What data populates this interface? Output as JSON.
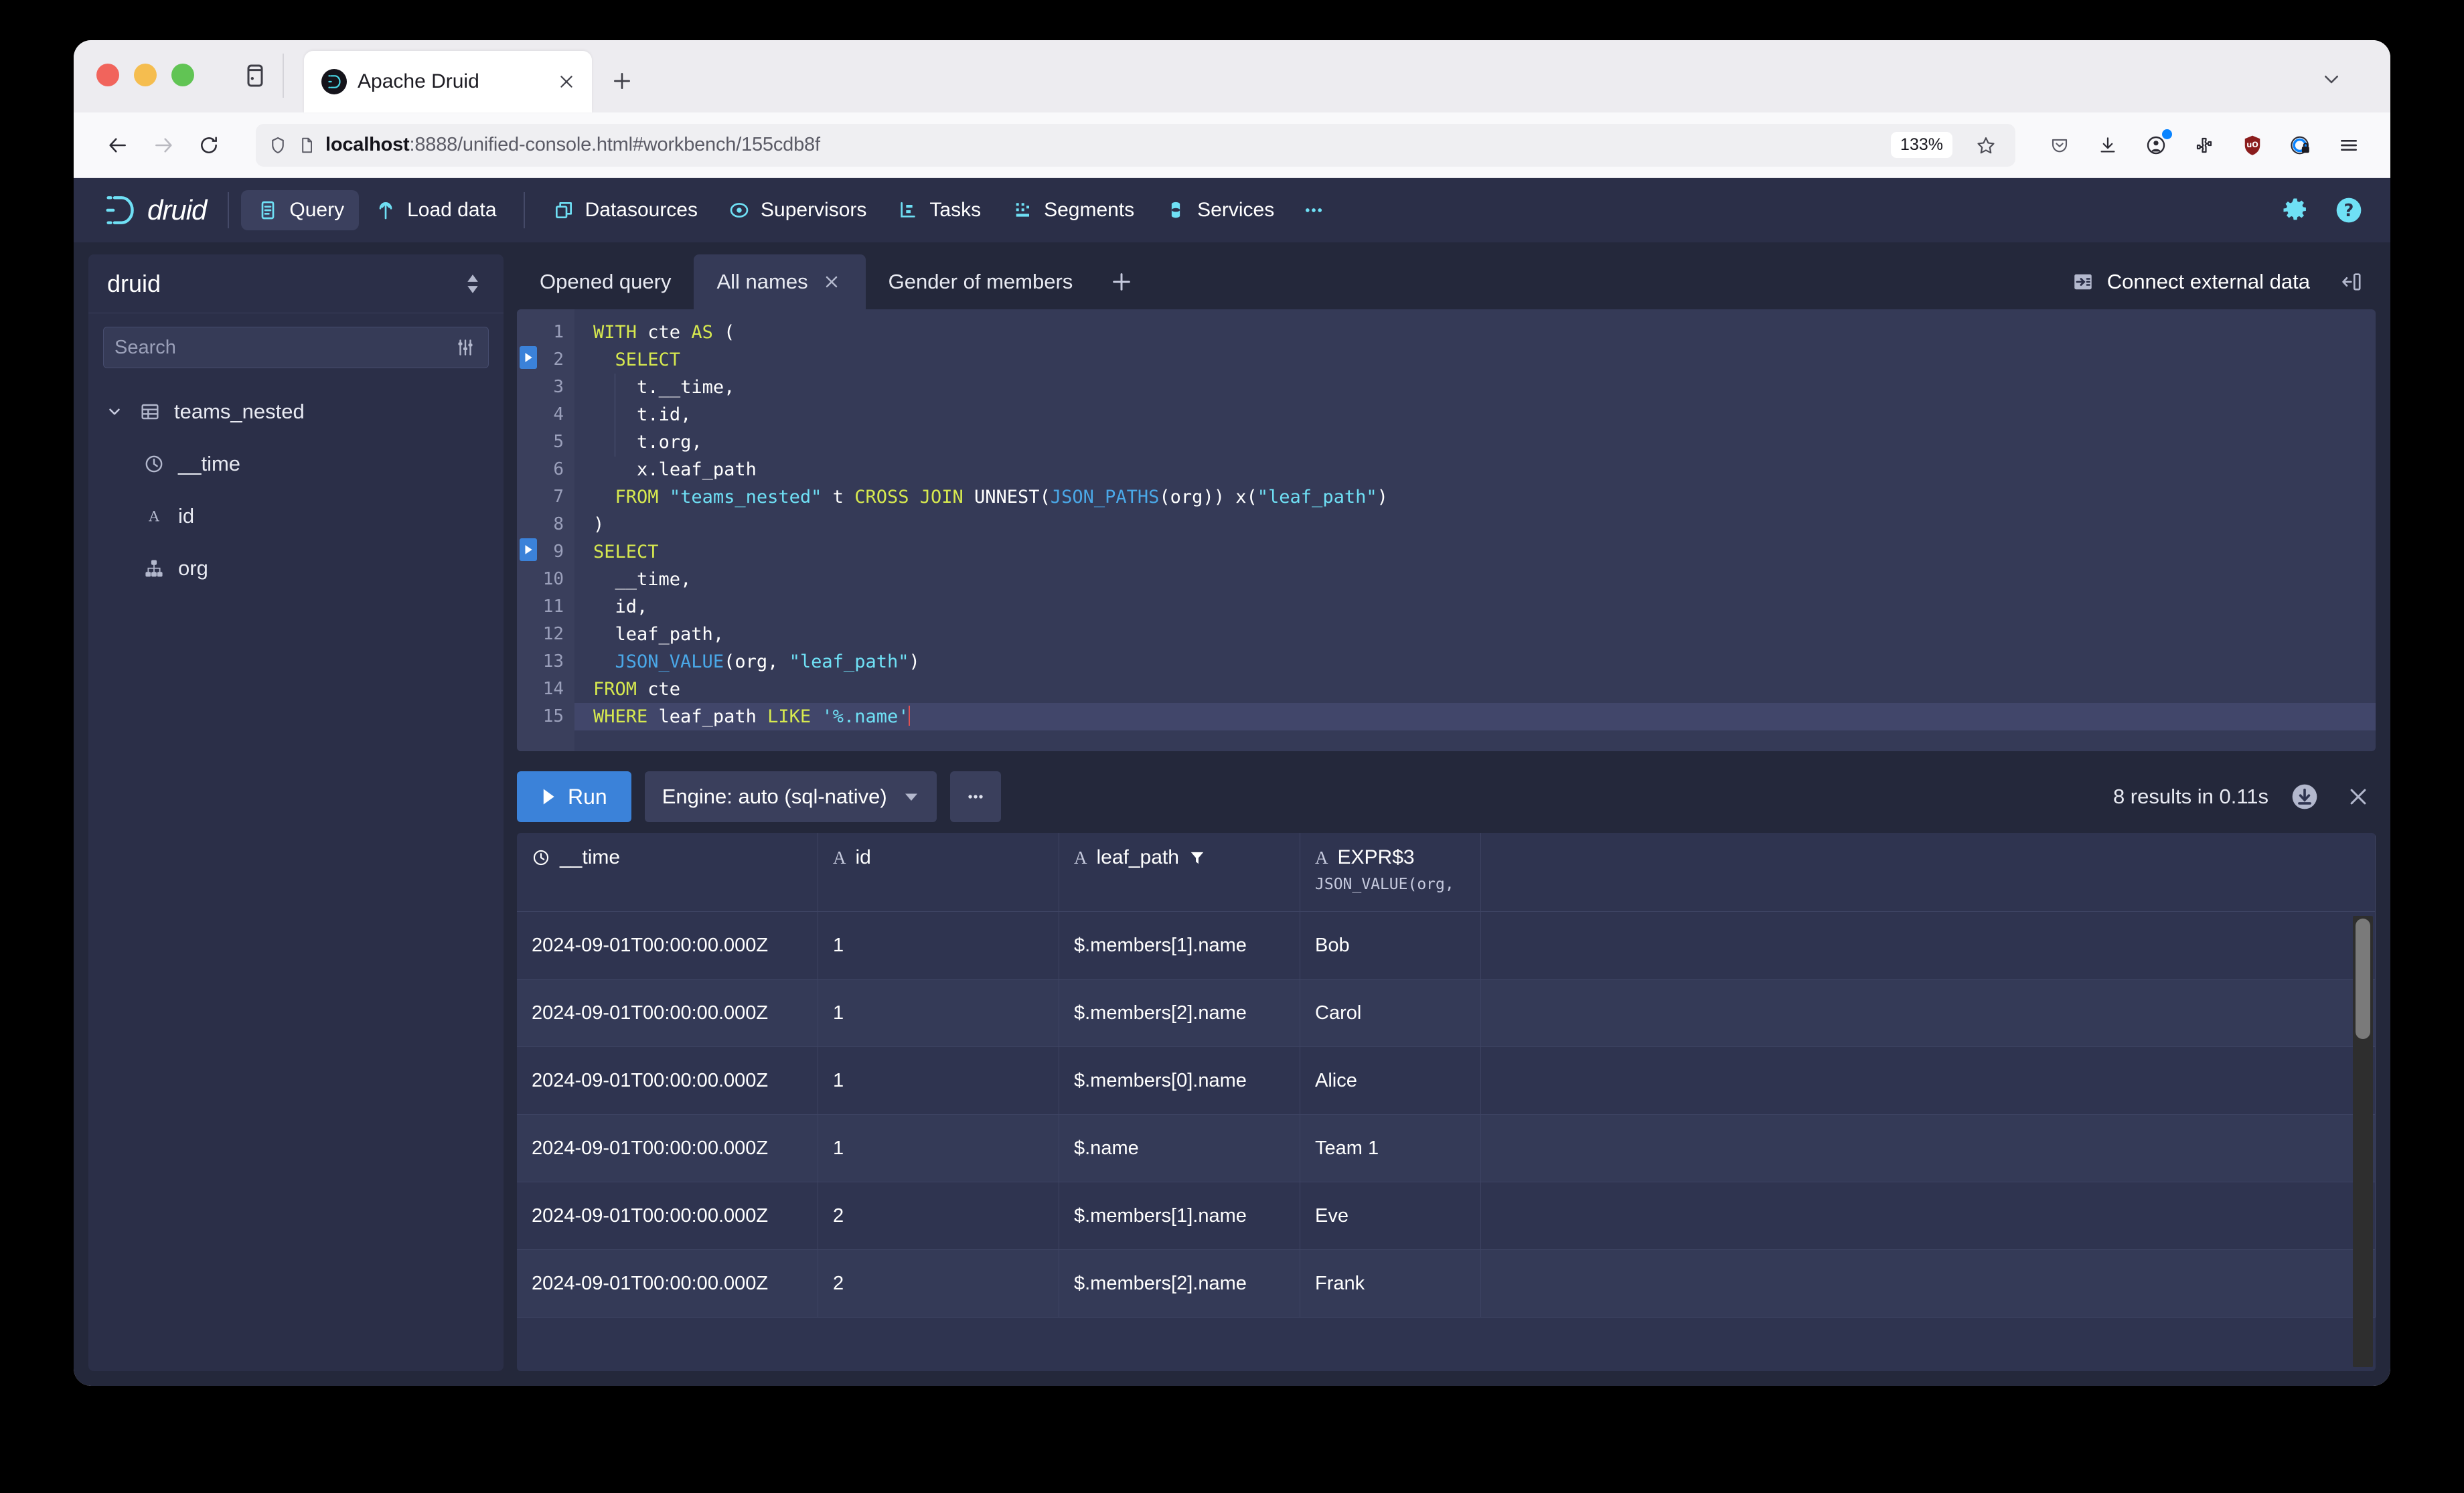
{
  "browser": {
    "tab": {
      "title": "Apache Druid",
      "favicon_icon": "druid-favicon",
      "close_icon": "close-icon"
    },
    "new_tab_icon": "plus-icon",
    "tab_list_icon": "chevron-down-icon",
    "sidebar_toggle_icon": "sidebar-toggle-icon",
    "back_icon": "back-arrow-icon",
    "forward_icon": "forward-arrow-icon",
    "reload_icon": "reload-icon",
    "shield_icon": "shield-icon",
    "page_icon": "page-info-icon",
    "url_host": "localhost",
    "url_rest": ":8888/unified-console.html#workbench/155cdb8f",
    "zoom_level": "133%",
    "bookmark_icon": "star-icon",
    "extensions": [
      {
        "name": "pocket-icon"
      },
      {
        "name": "downloads-icon"
      },
      {
        "name": "account-icon"
      },
      {
        "name": "extensions-puzzle-icon"
      },
      {
        "name": "ublock-origin-icon",
        "label": "uO"
      },
      {
        "name": "privacy-badger-icon"
      },
      {
        "name": "hamburger-menu-icon"
      }
    ]
  },
  "druid": {
    "logo_text": "druid",
    "nav": [
      {
        "label": "Query",
        "icon": "query-icon",
        "active": true
      },
      {
        "label": "Load data",
        "icon": "load-data-icon",
        "active": false
      },
      {
        "label": "Datasources",
        "icon": "datasources-icon",
        "active": false
      },
      {
        "label": "Supervisors",
        "icon": "supervisors-icon",
        "active": false
      },
      {
        "label": "Tasks",
        "icon": "tasks-icon",
        "active": false
      },
      {
        "label": "Segments",
        "icon": "segments-icon",
        "active": false
      },
      {
        "label": "Services",
        "icon": "services-icon",
        "active": false
      }
    ],
    "nav_more_icon": "more-horizontal-icon",
    "settings_icon": "gear-icon",
    "help_icon": "help-circle-icon",
    "accent_blue": "#3b82d9",
    "accent_cyan": "#6fe0f5",
    "panel_bg": "#2b2f48",
    "app_bg": "#24283b"
  },
  "sidebar": {
    "title": "druid",
    "sort_icon": "double-caret-icon",
    "search_placeholder": "Search",
    "search_value": "",
    "filter_icon": "filter-sliders-icon",
    "tree": [
      {
        "label": "teams_nested",
        "icon": "table-icon",
        "level": 0,
        "expanded": true,
        "chevron": "chevron-down-icon"
      },
      {
        "label": "__time",
        "icon": "clock-icon",
        "level": 1
      },
      {
        "label": "id",
        "icon": "string-type-icon",
        "level": 1
      },
      {
        "label": "org",
        "icon": "nested-type-icon",
        "level": 1
      }
    ]
  },
  "tabs": {
    "items": [
      {
        "label": "Opened query",
        "active": false,
        "closable": false
      },
      {
        "label": "All names",
        "active": true,
        "closable": true,
        "close_icon": "close-icon"
      },
      {
        "label": "Gender of members",
        "active": false,
        "closable": false
      }
    ],
    "add_icon": "plus-icon",
    "connect_external_label": "Connect external data",
    "connect_external_icon": "connect-external-icon",
    "collapse_icon": "collapse-panel-icon"
  },
  "editor": {
    "lines": [
      {
        "n": 1,
        "marker": false
      },
      {
        "n": 2,
        "marker": true
      },
      {
        "n": 3,
        "marker": false
      },
      {
        "n": 4,
        "marker": false
      },
      {
        "n": 5,
        "marker": false
      },
      {
        "n": 6,
        "marker": false
      },
      {
        "n": 7,
        "marker": false
      },
      {
        "n": 8,
        "marker": false
      },
      {
        "n": 9,
        "marker": true
      },
      {
        "n": 10,
        "marker": false
      },
      {
        "n": 11,
        "marker": false
      },
      {
        "n": 12,
        "marker": false
      },
      {
        "n": 13,
        "marker": false
      },
      {
        "n": 14,
        "marker": false
      },
      {
        "n": 15,
        "marker": false
      }
    ],
    "sql": "WITH cte AS (\n  SELECT\n    t.__time,\n    t.id,\n    t.org,\n    x.leaf_path\n  FROM \"teams_nested\" t CROSS JOIN UNNEST(JSON_PATHS(org)) x(\"leaf_path\")\n)\nSELECT\n  __time,\n  id,\n  leaf_path,\n  JSON_VALUE(org, \"leaf_path\")\nFROM cte\nWHERE leaf_path LIKE '%.name'",
    "current_line": 15,
    "run_marker_icon": "play-triangle-icon"
  },
  "runbar": {
    "run_label": "Run",
    "run_icon": "play-icon",
    "engine_label": "Engine: auto (sql-native)",
    "engine_caret_icon": "caret-down-icon",
    "more_icon": "more-horizontal-icon",
    "result_status": "8 results in 0.11s",
    "download_icon": "download-circle-icon",
    "close_icon": "close-icon"
  },
  "results": {
    "columns": [
      {
        "name": "__time",
        "type_glyph": "clock-icon",
        "sub": "",
        "filtered": false
      },
      {
        "name": "id",
        "type_glyph": "A",
        "sub": "",
        "filtered": false
      },
      {
        "name": "leaf_path",
        "type_glyph": "A",
        "sub": "",
        "filtered": true,
        "filter_icon": "filter-icon"
      },
      {
        "name": "EXPR$3",
        "type_glyph": "A",
        "sub": "JSON_VALUE(org, \"lea…",
        "filtered": false
      }
    ],
    "rows": [
      [
        "2024-09-01T00:00:00.000Z",
        "1",
        "$.members[1].name",
        "Bob"
      ],
      [
        "2024-09-01T00:00:00.000Z",
        "1",
        "$.members[2].name",
        "Carol"
      ],
      [
        "2024-09-01T00:00:00.000Z",
        "1",
        "$.members[0].name",
        "Alice"
      ],
      [
        "2024-09-01T00:00:00.000Z",
        "1",
        "$.name",
        "Team 1"
      ],
      [
        "2024-09-01T00:00:00.000Z",
        "2",
        "$.members[1].name",
        "Eve"
      ],
      [
        "2024-09-01T00:00:00.000Z",
        "2",
        "$.members[2].name",
        "Frank"
      ]
    ]
  }
}
